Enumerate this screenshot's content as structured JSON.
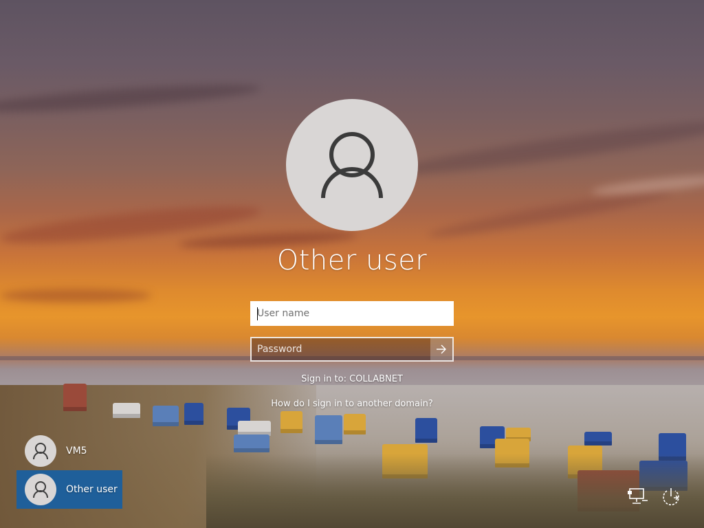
{
  "login": {
    "user_title": "Other user",
    "username_placeholder": "User name",
    "password_placeholder": "Password",
    "sign_in_to": "Sign in to: COLLABNET",
    "domain_link": "How do I sign in to another domain?"
  },
  "users": [
    {
      "name": "VM5",
      "selected": false
    },
    {
      "name": "Other user",
      "selected": true
    }
  ],
  "corner_icons": [
    "network-icon",
    "power-icon"
  ],
  "colors": {
    "selected_user_bg": "#1f5f9a",
    "avatar_bg": "#d9d6d5",
    "text": "#ffffff"
  }
}
